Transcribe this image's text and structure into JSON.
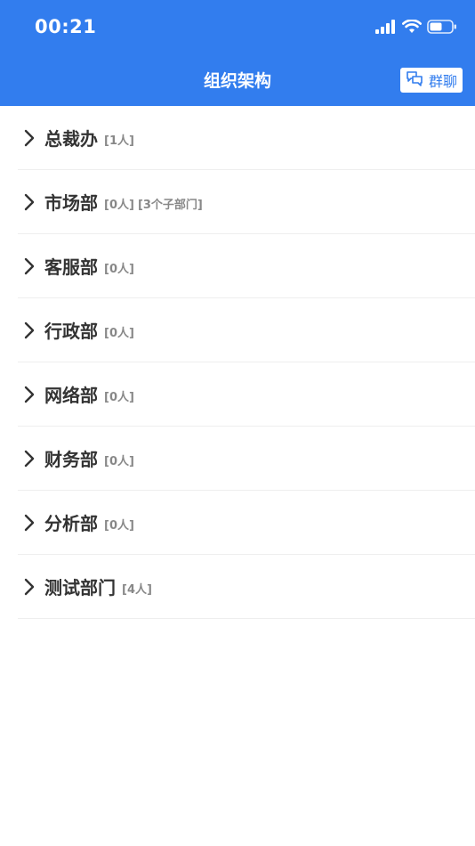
{
  "status_bar": {
    "time": "00:21"
  },
  "header": {
    "title": "组织架构",
    "group_chat_label": "群聊",
    "background_color": "#327DEE"
  },
  "departments": [
    {
      "name": "总裁办",
      "count": "[1人]",
      "sub": ""
    },
    {
      "name": "市场部",
      "count": "[0人]",
      "sub": "[3个子部门]"
    },
    {
      "name": "客服部",
      "count": "[0人]",
      "sub": ""
    },
    {
      "name": "行政部",
      "count": "[0人]",
      "sub": ""
    },
    {
      "name": "网络部",
      "count": "[0人]",
      "sub": ""
    },
    {
      "name": "财务部",
      "count": "[0人]",
      "sub": ""
    },
    {
      "name": "分析部",
      "count": "[0人]",
      "sub": ""
    },
    {
      "name": "测试部门",
      "count": "[4人]",
      "sub": ""
    }
  ]
}
